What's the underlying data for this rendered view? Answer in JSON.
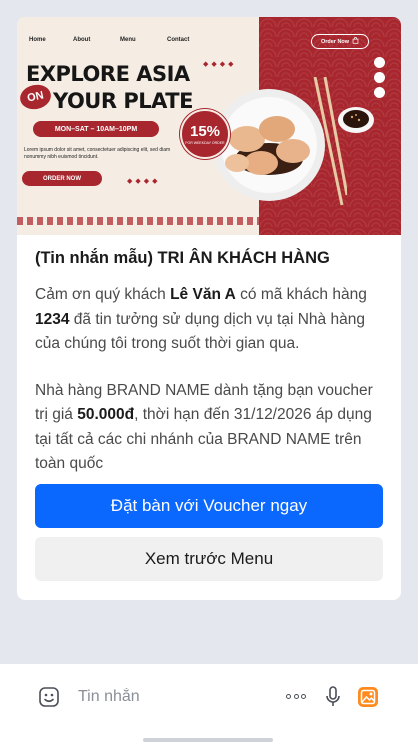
{
  "banner": {
    "nav": [
      "Home",
      "About",
      "Menu",
      "Contact"
    ],
    "order_now_top": "Order Now",
    "headline_line1": "EXPLORE ASIA",
    "headline_on": "ON",
    "headline_line2": "YOUR PLATE",
    "hours": "MON–SAT – 10AM–10PM",
    "lorem": "Lorem ipsum dolor sit amet, consectetuer adipiscing elit, sed diam nonummy nibh euismod tincidunt.",
    "order_now_button": "ORDER NOW",
    "discount": "15%",
    "discount_sub": "FOR WEEKDAY ORDER",
    "accent_color": "#a8262e"
  },
  "message": {
    "title": "(Tin nhắn mẫu) TRI ÂN KHÁCH HÀNG",
    "p1_before": "Cảm ơn quý khách ",
    "customer_name": "Lê Văn A",
    "p1_mid": " có mã khách hàng ",
    "customer_code": "1234",
    "p1_after": " đã tin tưởng sử dụng dịch vụ tại Nhà hàng của chúng tôi trong suốt thời gian qua.",
    "p2_before": "Nhà hàng BRAND NAME dành tặng bạn voucher trị giá ",
    "voucher_value": "50.000đ",
    "p2_after": ", thời hạn đến 31/12/2026 áp dụng tại tất cả các chi nhánh của BRAND NAME trên toàn quốc"
  },
  "buttons": {
    "primary": "Đặt bàn với Voucher ngay",
    "secondary": "Xem trước Menu",
    "primary_color": "#0a68ff"
  },
  "composer": {
    "placeholder": "Tin nhắn",
    "icons": [
      "emoji-icon",
      "more-icon",
      "microphone-icon",
      "image-icon"
    ]
  }
}
